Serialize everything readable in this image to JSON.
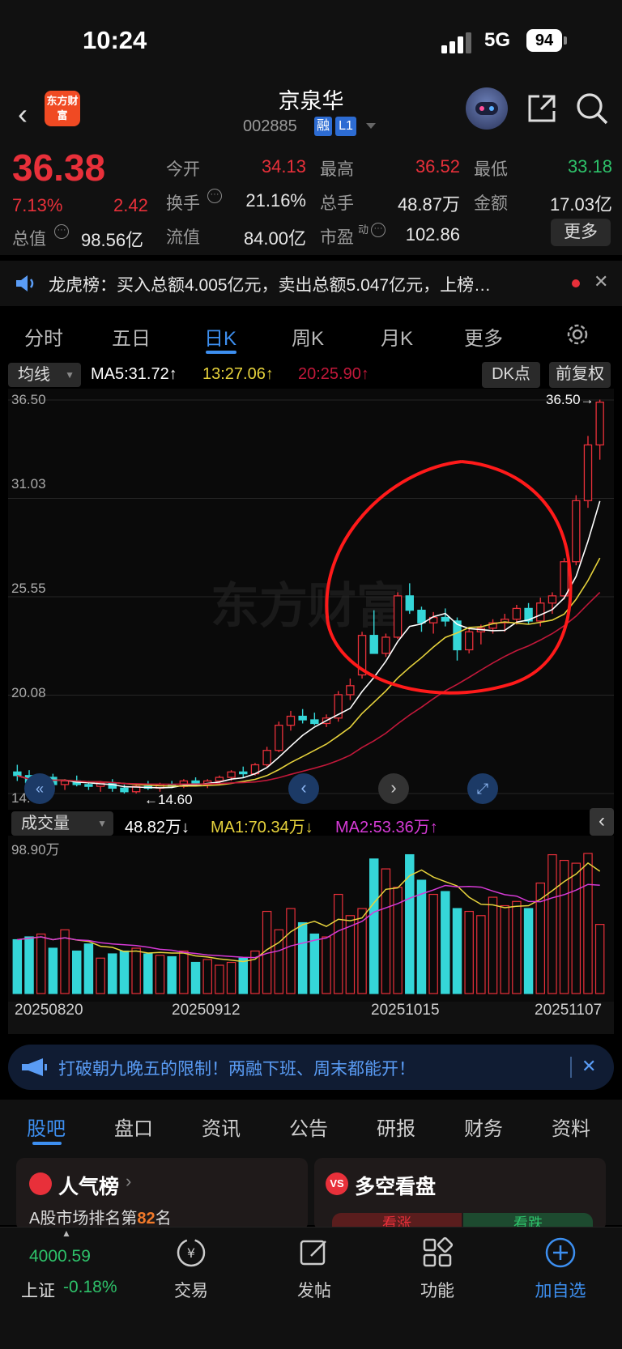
{
  "status_bar": {
    "time": "10:24",
    "network": "5G",
    "battery": "94"
  },
  "header": {
    "stock_name": "京泉华",
    "stock_code": "002885",
    "tag_margin": "融",
    "tag_level": "L1",
    "logo_text": "东方财富"
  },
  "quote": {
    "price": "36.38",
    "change_pct": "7.13%",
    "change": "2.42",
    "total_mv_label": "总值",
    "total_mv": "98.56亿",
    "fields": [
      {
        "label": "今开",
        "value": "34.13"
      },
      {
        "label": "最高",
        "value": "36.52"
      },
      {
        "label": "最低",
        "value": "33.18"
      },
      {
        "label": "换手",
        "value": "21.16%"
      },
      {
        "label": "总手",
        "value": "48.87万"
      },
      {
        "label": "金额",
        "value": "17.03亿"
      },
      {
        "label": "流值",
        "value": "84.00亿"
      },
      {
        "label": "市盈",
        "value": "102.86"
      }
    ],
    "pe_sup": "动",
    "more": "更多"
  },
  "news": {
    "text": "龙虎榜：买入总额4.005亿元，卖出总额5.047亿元，上榜…"
  },
  "period_tabs": [
    "分时",
    "五日",
    "日K",
    "周K",
    "月K",
    "更多"
  ],
  "active_period": "日K",
  "chart_toolbar": {
    "indicator": "均线",
    "ma5": "MA5:31.72↑",
    "ma10": "13:27.06↑",
    "ma20": "20:25.90↑",
    "dk": "DK点",
    "adjust": "前复权"
  },
  "chart": {
    "y_labels": [
      "36.50",
      "31.03",
      "25.55",
      "20.08",
      "14.60"
    ],
    "max_label": "36.50→",
    "min_label": "←14.60",
    "watermark": "东方财富"
  },
  "volume_toolbar": {
    "label": "成交量",
    "vol": "48.82万↓",
    "ma1": "MA1:70.34万↓",
    "ma2": "MA2:53.36万↑",
    "top_label": "98.90万"
  },
  "dates": [
    "20250820",
    "20250912",
    "20251015",
    "20251107"
  ],
  "promo": {
    "text": "打破朝九晚五的限制！两融下班、周末都能开！"
  },
  "bottom_tabs": [
    "股吧",
    "盘口",
    "资讯",
    "公告",
    "研报",
    "财务",
    "资料"
  ],
  "cards": {
    "popularity": {
      "title": "人气榜",
      "text_prefix": "A股市场排名第",
      "rank": "82",
      "text_suffix": "名"
    },
    "bullbear": {
      "title": "多空看盘",
      "bull": "看涨",
      "bear": "看跌"
    }
  },
  "bottom_nav": {
    "index_value": "4000.59",
    "index_name": "上证",
    "index_change": "-0.18%",
    "items": [
      "交易",
      "发帖",
      "功能",
      "加自选"
    ]
  },
  "colors": {
    "up": "#e8303a",
    "down": "#35d6d8",
    "accent": "#3d8ff0",
    "ma5": "#ffffff",
    "ma10": "#e6d23c",
    "ma20": "#c2183a"
  },
  "chart_data": {
    "type": "candlestick",
    "ohlc_up_count_hint": "",
    "candles": [
      [
        15.8,
        16.2,
        15.3,
        15.6
      ],
      [
        15.6,
        15.9,
        15.0,
        15.2
      ],
      [
        15.2,
        15.6,
        14.9,
        15.5
      ],
      [
        15.5,
        15.7,
        15.0,
        15.1
      ],
      [
        15.1,
        15.4,
        14.8,
        15.3
      ],
      [
        15.3,
        15.6,
        15.0,
        15.1
      ],
      [
        15.1,
        15.3,
        14.8,
        15.0
      ],
      [
        15.0,
        15.3,
        14.7,
        15.2
      ],
      [
        15.2,
        15.4,
        14.7,
        14.9
      ],
      [
        14.9,
        15.1,
        14.6,
        14.7
      ],
      [
        14.7,
        15.1,
        14.6,
        15.0
      ],
      [
        15.0,
        15.3,
        14.8,
        14.9
      ],
      [
        14.9,
        15.2,
        14.7,
        15.1
      ],
      [
        15.1,
        15.3,
        14.9,
        15.0
      ],
      [
        15.0,
        15.4,
        14.9,
        15.3
      ],
      [
        15.3,
        15.5,
        15.0,
        15.1
      ],
      [
        15.1,
        15.4,
        14.9,
        15.3
      ],
      [
        15.3,
        15.6,
        15.1,
        15.5
      ],
      [
        15.5,
        15.9,
        15.3,
        15.8
      ],
      [
        15.8,
        16.1,
        15.5,
        15.7
      ],
      [
        15.7,
        16.3,
        15.6,
        16.2
      ],
      [
        16.2,
        17.2,
        16.1,
        17.0
      ],
      [
        17.0,
        18.6,
        16.9,
        18.4
      ],
      [
        18.4,
        19.2,
        18.1,
        18.9
      ],
      [
        18.9,
        19.3,
        18.5,
        18.7
      ],
      [
        18.7,
        19.1,
        18.4,
        18.5
      ],
      [
        18.5,
        19.0,
        18.3,
        18.8
      ],
      [
        18.8,
        20.3,
        18.6,
        20.1
      ],
      [
        20.1,
        21.0,
        19.8,
        20.6
      ],
      [
        21.2,
        23.6,
        21.0,
        23.4
      ],
      [
        23.4,
        24.8,
        22.8,
        22.4
      ],
      [
        22.4,
        23.5,
        22.2,
        23.3
      ],
      [
        23.3,
        25.8,
        23.2,
        25.6
      ],
      [
        25.6,
        26.3,
        24.6,
        24.8
      ],
      [
        24.8,
        25.0,
        23.6,
        24.1
      ],
      [
        24.1,
        24.7,
        23.5,
        24.4
      ],
      [
        24.4,
        24.9,
        23.9,
        24.2
      ],
      [
        24.2,
        24.4,
        22.0,
        22.6
      ],
      [
        22.6,
        23.8,
        22.4,
        23.6
      ],
      [
        23.6,
        24.0,
        22.9,
        23.8
      ],
      [
        23.8,
        24.3,
        23.5,
        24.1
      ],
      [
        24.1,
        24.6,
        23.6,
        24.3
      ],
      [
        24.3,
        25.1,
        24.0,
        24.9
      ],
      [
        24.9,
        25.2,
        24.0,
        24.2
      ],
      [
        24.2,
        25.5,
        23.9,
        25.2
      ],
      [
        25.2,
        25.8,
        24.6,
        25.6
      ],
      [
        25.6,
        27.7,
        25.4,
        27.5
      ],
      [
        27.5,
        31.2,
        27.3,
        30.9
      ],
      [
        30.9,
        34.5,
        30.5,
        34.0
      ],
      [
        34.0,
        36.52,
        33.18,
        36.38
      ]
    ],
    "ylim": [
      14.6,
      36.5
    ],
    "volume": [
      38,
      40,
      42,
      32,
      45,
      30,
      35,
      25,
      28,
      30,
      32,
      28,
      27,
      26,
      30,
      22,
      24,
      20,
      22,
      25,
      30,
      58,
      45,
      60,
      50,
      42,
      40,
      70,
      55,
      60,
      95,
      88,
      75,
      98,
      80,
      70,
      72,
      60,
      58,
      55,
      68,
      62,
      65,
      60,
      78,
      98,
      94,
      92,
      98.9,
      48.8
    ],
    "volume_ylim": [
      0,
      98.9
    ],
    "date_ticks": [
      "20250820",
      "20250912",
      "20251015",
      "20251107"
    ]
  }
}
